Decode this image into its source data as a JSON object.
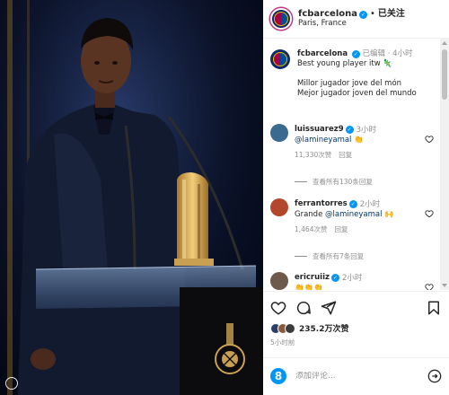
{
  "post": {
    "username": "fcbarcelona",
    "follow_state": "已关注",
    "location": "Paris, France"
  },
  "caption": {
    "username": "fcbarcelona",
    "edited": "已编辑",
    "time": "4小时",
    "line1": "Best young player itw 🦎",
    "line2": "Millor jugador jove del món",
    "line3": "Mejor jugador joven del mundo"
  },
  "comments": [
    {
      "username": "luissuarez9",
      "time": "3小时",
      "mention": "@lamineyamal",
      "text": " 👏",
      "likes": "11,330次赞",
      "reply": "回复",
      "view_replies": "查看所有130条回复",
      "avatar_color": "#3a6a8f"
    },
    {
      "username": "ferrantorres",
      "time": "2小时",
      "prefix": "Grande ",
      "mention": "@lamineyamal",
      "text": " 🙌",
      "likes": "1,464次赞",
      "reply": "回复",
      "view_replies": "查看所有7条回复",
      "avatar_color": "#b2472c"
    },
    {
      "username": "ericruiiz",
      "time": "2小时",
      "text": "👏👏👏",
      "avatar_color": "#6d5a4a"
    }
  ],
  "likes_text": "235.2万次赞",
  "time_ago": "5小时前",
  "add_comment_placeholder": "添加评论...",
  "colors": {
    "accent_blue": "#0095f6",
    "barca_blue": "#004d98",
    "barca_red": "#a50044",
    "barca_gold": "#edbb00",
    "muted": "#8e8e8e",
    "stage_bg": "#0a1128"
  },
  "icons": [
    "heart-icon",
    "comment-icon",
    "share-icon",
    "bookmark-icon",
    "emoji-icon",
    "send-icon"
  ]
}
